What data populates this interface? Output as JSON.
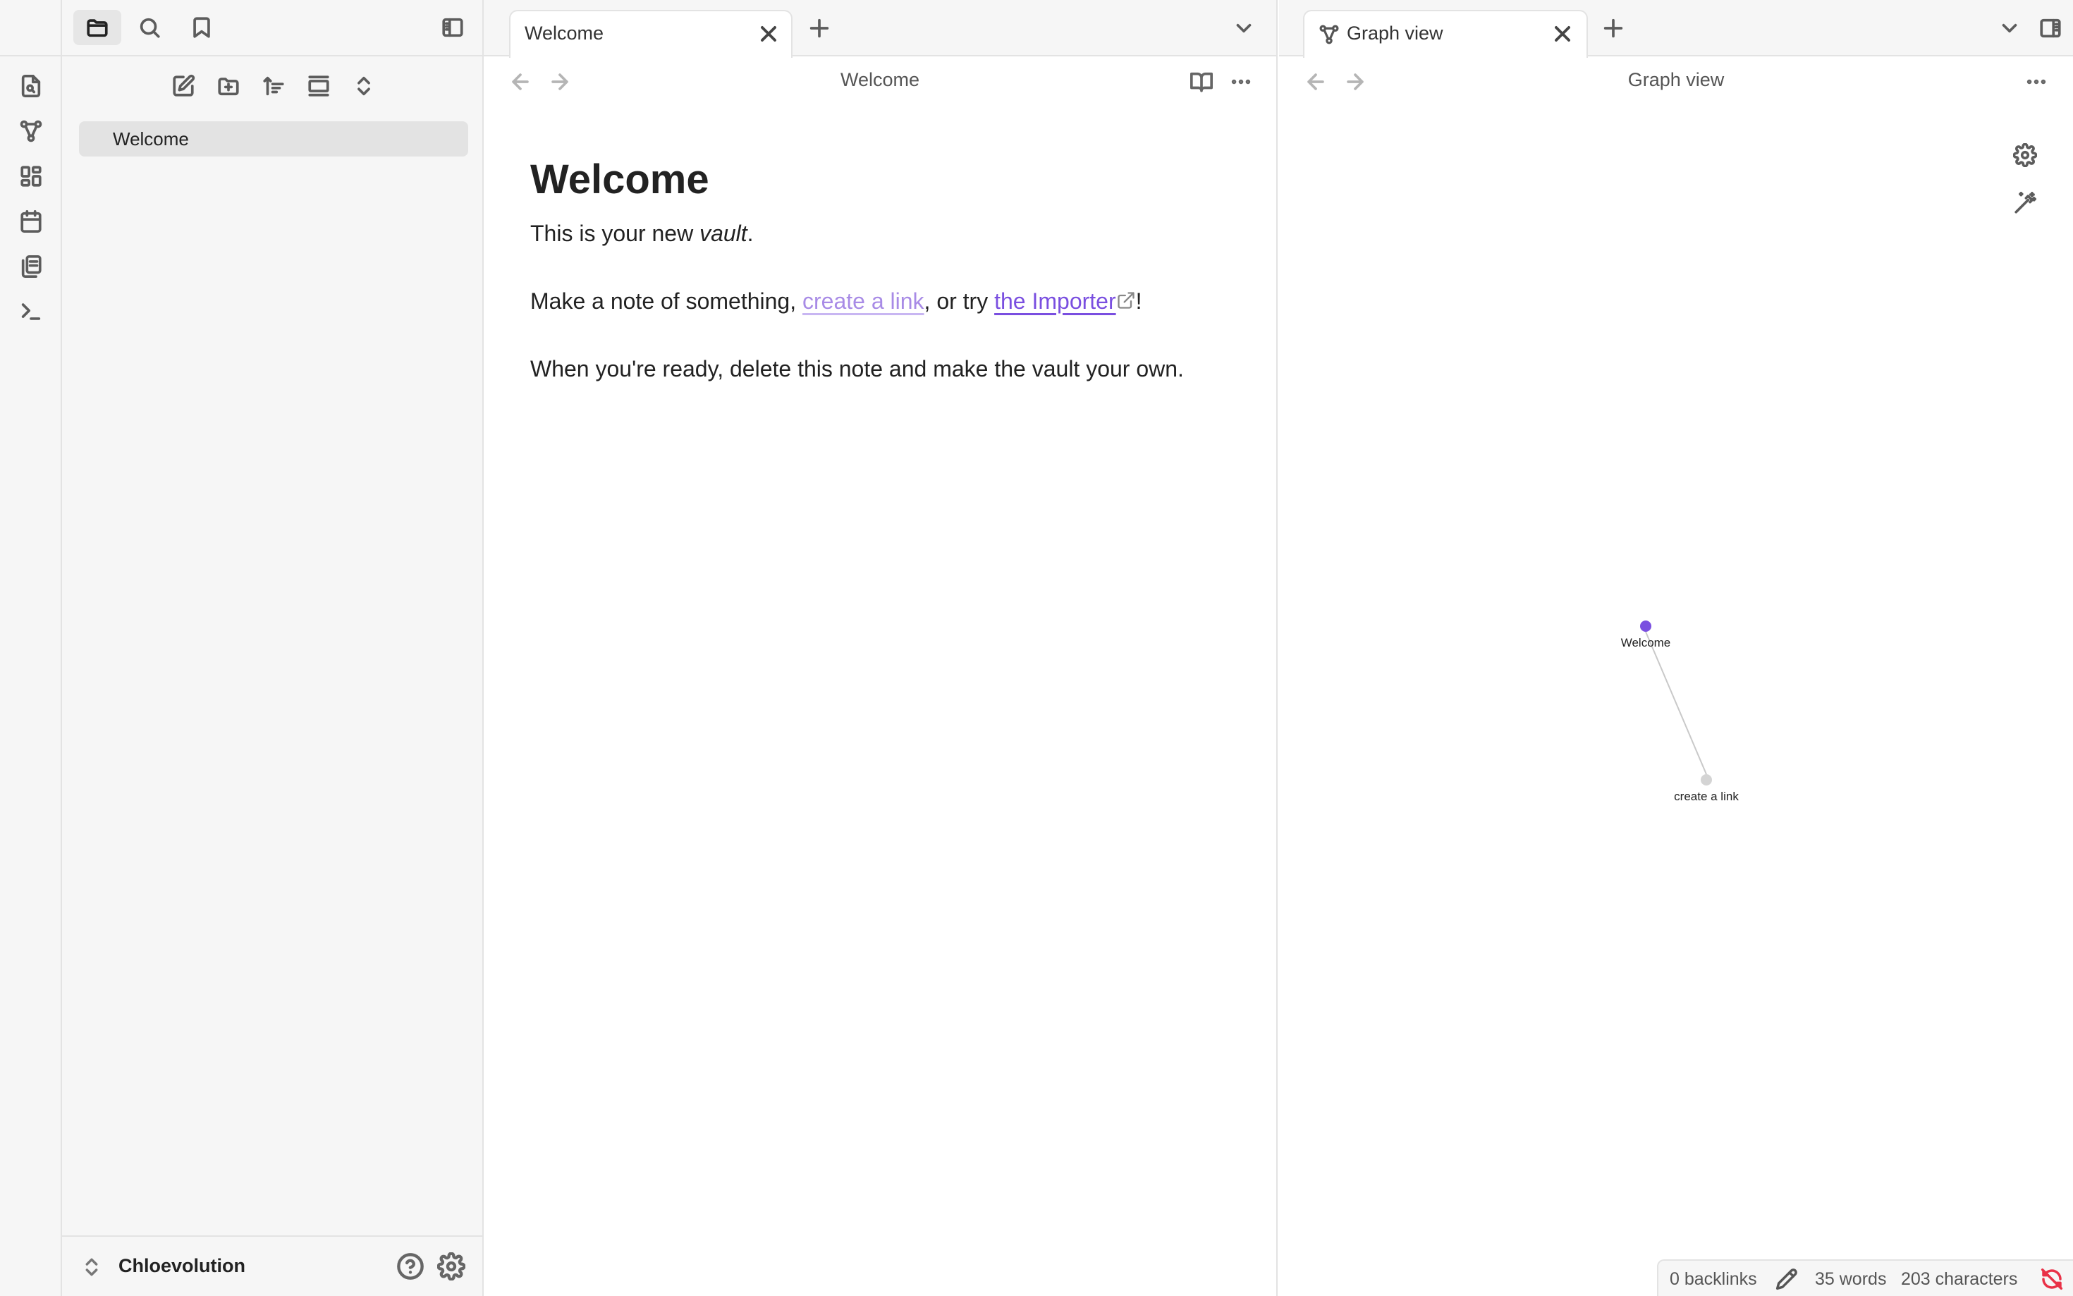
{
  "colors": {
    "accent": "#7a4fe0",
    "internal_link": "#a88be6",
    "sync_error": "#e93147",
    "graph_node_active": "#7a4fe0",
    "graph_node_inactive": "#d4d4d4"
  },
  "ribbon": {
    "items": [
      "open-quick-switcher-icon",
      "graph-view-icon",
      "canvas-icon",
      "daily-note-icon",
      "templates-icon",
      "command-palette-icon"
    ]
  },
  "sidebar": {
    "tabs": [
      "files-icon",
      "search-icon",
      "bookmarks-icon"
    ],
    "nav_actions": [
      "new-note-icon",
      "new-folder-icon",
      "sort-icon",
      "auto-reveal-icon",
      "collapse-all-icon"
    ],
    "files": [
      {
        "name": "Welcome"
      }
    ],
    "vault_name": "Chloevolution"
  },
  "left_pane": {
    "tab_title": "Welcome",
    "view_title": "Welcome",
    "note": {
      "heading": "Welcome",
      "p1_before": "This is your new ",
      "p1_em": "vault",
      "p1_after": ".",
      "p2_before": "Make a note of something, ",
      "p2_internal_link": "create a link",
      "p2_middle": ", or try ",
      "p2_external_link": "the Importer",
      "p2_after": "!",
      "p3": "When you're ready, delete this note and make the vault your own."
    }
  },
  "right_pane": {
    "tab_title": "Graph view",
    "view_title": "Graph view",
    "graph": {
      "nodes": [
        {
          "id": "welcome",
          "label": "Welcome",
          "active": true
        },
        {
          "id": "create-a-link",
          "label": "create a link",
          "active": false
        }
      ],
      "edges": [
        {
          "from": "welcome",
          "to": "create-a-link"
        }
      ]
    }
  },
  "status_bar": {
    "backlinks": "0 backlinks",
    "words": "35 words",
    "characters": "203 characters"
  }
}
